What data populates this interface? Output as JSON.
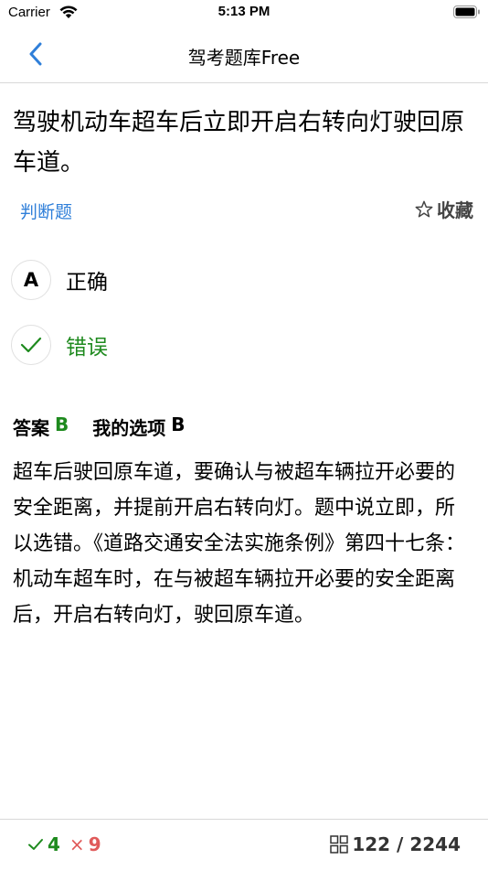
{
  "status_bar": {
    "carrier": "Carrier",
    "time": "5:13 PM"
  },
  "nav": {
    "title": "驾考题库Free",
    "back_icon": "chevron-left-icon"
  },
  "question": {
    "text": "驾驶机动车超车后立即开启右转向灯驶回原车道。",
    "type": "判断题",
    "favorite_label": "收藏"
  },
  "options": [
    {
      "marker": "A",
      "text": "正确",
      "state": "normal"
    },
    {
      "marker": "✓",
      "text": "错误",
      "state": "correct"
    }
  ],
  "answer": {
    "label": "答案",
    "value": "B",
    "my_choice_label": "我的选项",
    "my_choice_value": "B"
  },
  "explanation": "超车后驶回原车道，要确认与被超车辆拉开必要的安全距离，并提前开启右转向灯。题中说立即，所以选错。《道路交通安全法实施条例》第四十七条：机动车超车时，在与被超车辆拉开必要的安全距离后，开启右转向灯，驶回原车道。",
  "footer": {
    "correct_count": "4",
    "wrong_mark": "×",
    "wrong_count": "9",
    "progress": "122 / 2244"
  },
  "colors": {
    "accent_blue": "#2f7fd9",
    "correct_green": "#1e8a1e",
    "wrong_red": "#e05a5a"
  }
}
